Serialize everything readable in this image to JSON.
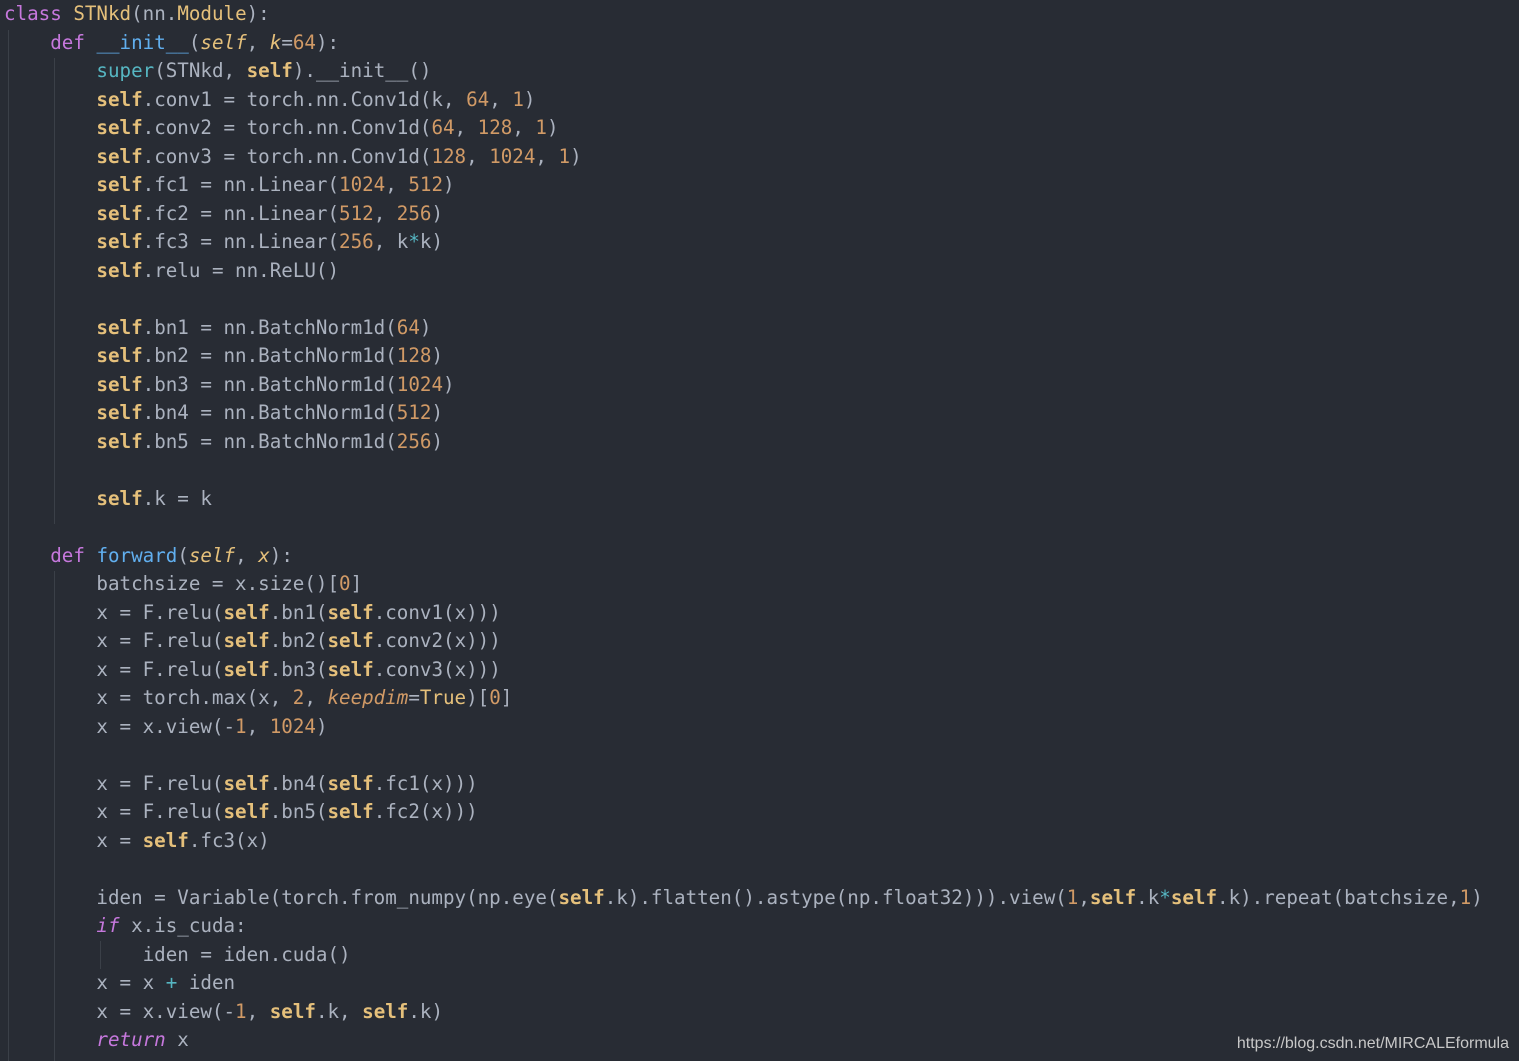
{
  "colors": {
    "background": "#282c34",
    "keyword": "#c678dd",
    "class_name": "#e5c07b",
    "function_name": "#61afef",
    "builtin": "#56b6c2",
    "number": "#d19a66",
    "text": "#abb2bf"
  },
  "code": {
    "lines": [
      [
        [
          "kw",
          "class"
        ],
        [
          "t",
          " "
        ],
        [
          "cls",
          "STNkd"
        ],
        [
          "t",
          "(nn."
        ],
        [
          "cls",
          "Module"
        ],
        [
          "t",
          "):"
        ]
      ],
      [
        [
          "t",
          "    "
        ],
        [
          "kw",
          "def"
        ],
        [
          "t",
          " "
        ],
        [
          "fn",
          "__init__"
        ],
        [
          "t",
          "("
        ],
        [
          "selfp",
          "self"
        ],
        [
          "t",
          ", "
        ],
        [
          "param",
          "k"
        ],
        [
          "t",
          "="
        ],
        [
          "num",
          "64"
        ],
        [
          "t",
          "):"
        ]
      ],
      [
        [
          "t",
          "        "
        ],
        [
          "blt",
          "super"
        ],
        [
          "t",
          "(STNkd, "
        ],
        [
          "self",
          "self"
        ],
        [
          "t",
          ")."
        ],
        [
          "t",
          "__init__"
        ],
        [
          "t",
          "()"
        ]
      ],
      [
        [
          "t",
          "        "
        ],
        [
          "self",
          "self"
        ],
        [
          "t",
          ".conv1 = torch.nn.Conv1d(k, "
        ],
        [
          "num",
          "64"
        ],
        [
          "t",
          ", "
        ],
        [
          "num",
          "1"
        ],
        [
          "t",
          ")"
        ]
      ],
      [
        [
          "t",
          "        "
        ],
        [
          "self",
          "self"
        ],
        [
          "t",
          ".conv2 = torch.nn.Conv1d("
        ],
        [
          "num",
          "64"
        ],
        [
          "t",
          ", "
        ],
        [
          "num",
          "128"
        ],
        [
          "t",
          ", "
        ],
        [
          "num",
          "1"
        ],
        [
          "t",
          ")"
        ]
      ],
      [
        [
          "t",
          "        "
        ],
        [
          "self",
          "self"
        ],
        [
          "t",
          ".conv3 = torch.nn.Conv1d("
        ],
        [
          "num",
          "128"
        ],
        [
          "t",
          ", "
        ],
        [
          "num",
          "1024"
        ],
        [
          "t",
          ", "
        ],
        [
          "num",
          "1"
        ],
        [
          "t",
          ")"
        ]
      ],
      [
        [
          "t",
          "        "
        ],
        [
          "self",
          "self"
        ],
        [
          "t",
          ".fc1 = nn.Linear("
        ],
        [
          "num",
          "1024"
        ],
        [
          "t",
          ", "
        ],
        [
          "num",
          "512"
        ],
        [
          "t",
          ")"
        ]
      ],
      [
        [
          "t",
          "        "
        ],
        [
          "self",
          "self"
        ],
        [
          "t",
          ".fc2 = nn.Linear("
        ],
        [
          "num",
          "512"
        ],
        [
          "t",
          ", "
        ],
        [
          "num",
          "256"
        ],
        [
          "t",
          ")"
        ]
      ],
      [
        [
          "t",
          "        "
        ],
        [
          "self",
          "self"
        ],
        [
          "t",
          ".fc3 = nn.Linear("
        ],
        [
          "num",
          "256"
        ],
        [
          "t",
          ", k"
        ],
        [
          "op",
          "*"
        ],
        [
          "t",
          "k)"
        ]
      ],
      [
        [
          "t",
          "        "
        ],
        [
          "self",
          "self"
        ],
        [
          "t",
          ".relu = nn.ReLU()"
        ]
      ],
      [
        [
          "t",
          ""
        ]
      ],
      [
        [
          "t",
          "        "
        ],
        [
          "self",
          "self"
        ],
        [
          "t",
          ".bn1 = nn.BatchNorm1d("
        ],
        [
          "num",
          "64"
        ],
        [
          "t",
          ")"
        ]
      ],
      [
        [
          "t",
          "        "
        ],
        [
          "self",
          "self"
        ],
        [
          "t",
          ".bn2 = nn.BatchNorm1d("
        ],
        [
          "num",
          "128"
        ],
        [
          "t",
          ")"
        ]
      ],
      [
        [
          "t",
          "        "
        ],
        [
          "self",
          "self"
        ],
        [
          "t",
          ".bn3 = nn.BatchNorm1d("
        ],
        [
          "num",
          "1024"
        ],
        [
          "t",
          ")"
        ]
      ],
      [
        [
          "t",
          "        "
        ],
        [
          "self",
          "self"
        ],
        [
          "t",
          ".bn4 = nn.BatchNorm1d("
        ],
        [
          "num",
          "512"
        ],
        [
          "t",
          ")"
        ]
      ],
      [
        [
          "t",
          "        "
        ],
        [
          "self",
          "self"
        ],
        [
          "t",
          ".bn5 = nn.BatchNorm1d("
        ],
        [
          "num",
          "256"
        ],
        [
          "t",
          ")"
        ]
      ],
      [
        [
          "t",
          ""
        ]
      ],
      [
        [
          "t",
          "        "
        ],
        [
          "self",
          "self"
        ],
        [
          "t",
          ".k = k"
        ]
      ],
      [
        [
          "t",
          ""
        ]
      ],
      [
        [
          "t",
          "    "
        ],
        [
          "kw",
          "def"
        ],
        [
          "t",
          " "
        ],
        [
          "fn",
          "forward"
        ],
        [
          "t",
          "("
        ],
        [
          "selfp",
          "self"
        ],
        [
          "t",
          ", "
        ],
        [
          "param",
          "x"
        ],
        [
          "t",
          "):"
        ]
      ],
      [
        [
          "t",
          "        batchsize = x.size()["
        ],
        [
          "num",
          "0"
        ],
        [
          "t",
          "]"
        ]
      ],
      [
        [
          "t",
          "        x = F.relu("
        ],
        [
          "self",
          "self"
        ],
        [
          "t",
          ".bn1("
        ],
        [
          "self",
          "self"
        ],
        [
          "t",
          ".conv1(x)))"
        ]
      ],
      [
        [
          "t",
          "        x = F.relu("
        ],
        [
          "self",
          "self"
        ],
        [
          "t",
          ".bn2("
        ],
        [
          "self",
          "self"
        ],
        [
          "t",
          ".conv2(x)))"
        ]
      ],
      [
        [
          "t",
          "        x = F.relu("
        ],
        [
          "self",
          "self"
        ],
        [
          "t",
          ".bn3("
        ],
        [
          "self",
          "self"
        ],
        [
          "t",
          ".conv3(x)))"
        ]
      ],
      [
        [
          "t",
          "        x = torch.max(x, "
        ],
        [
          "num",
          "2"
        ],
        [
          "t",
          ", "
        ],
        [
          "kwarg",
          "keepdim"
        ],
        [
          "t",
          "="
        ],
        [
          "cls",
          "True"
        ],
        [
          "t",
          ")["
        ],
        [
          "num",
          "0"
        ],
        [
          "t",
          "]"
        ]
      ],
      [
        [
          "t",
          "        x = x.view(-"
        ],
        [
          "num",
          "1"
        ],
        [
          "t",
          ", "
        ],
        [
          "num",
          "1024"
        ],
        [
          "t",
          ")"
        ]
      ],
      [
        [
          "t",
          ""
        ]
      ],
      [
        [
          "t",
          "        x = F.relu("
        ],
        [
          "self",
          "self"
        ],
        [
          "t",
          ".bn4("
        ],
        [
          "self",
          "self"
        ],
        [
          "t",
          ".fc1(x)))"
        ]
      ],
      [
        [
          "t",
          "        x = F.relu("
        ],
        [
          "self",
          "self"
        ],
        [
          "t",
          ".bn5("
        ],
        [
          "self",
          "self"
        ],
        [
          "t",
          ".fc2(x)))"
        ]
      ],
      [
        [
          "t",
          "        x = "
        ],
        [
          "self",
          "self"
        ],
        [
          "t",
          ".fc3(x)"
        ]
      ],
      [
        [
          "t",
          ""
        ]
      ],
      [
        [
          "t",
          "        iden = Variable(torch.from_numpy(np.eye("
        ],
        [
          "self",
          "self"
        ],
        [
          "t",
          ".k).flatten().astype(np.float32))).view("
        ],
        [
          "num",
          "1"
        ],
        [
          "t",
          ","
        ],
        [
          "self",
          "self"
        ],
        [
          "t",
          ".k"
        ],
        [
          "op",
          "*"
        ],
        [
          "self",
          "self"
        ],
        [
          "t",
          ".k).repeat(batchsize,"
        ],
        [
          "num",
          "1"
        ],
        [
          "t",
          ")"
        ]
      ],
      [
        [
          "t",
          "        "
        ],
        [
          "kwi",
          "if"
        ],
        [
          "t",
          " x.is_cuda:"
        ]
      ],
      [
        [
          "t",
          "            iden = iden.cuda()"
        ]
      ],
      [
        [
          "t",
          "        x = x "
        ],
        [
          "op",
          "+"
        ],
        [
          "t",
          " iden"
        ]
      ],
      [
        [
          "t",
          "        x = x.view(-"
        ],
        [
          "num",
          "1"
        ],
        [
          "t",
          ", "
        ],
        [
          "self",
          "self"
        ],
        [
          "t",
          ".k, "
        ],
        [
          "self",
          "self"
        ],
        [
          "t",
          ".k)"
        ]
      ],
      [
        [
          "t",
          "        "
        ],
        [
          "kwi",
          "return"
        ],
        [
          "t",
          " x"
        ]
      ]
    ]
  },
  "watermark": "https://blog.csdn.net/MIRCALEformula"
}
